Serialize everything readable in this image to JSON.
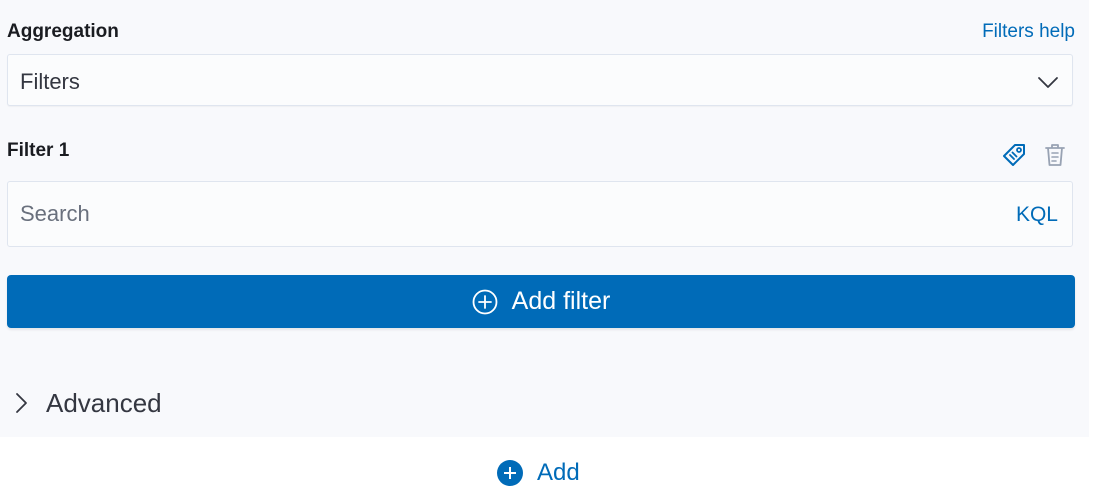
{
  "aggregation": {
    "label": "Aggregation",
    "help_link": "Filters help",
    "selected": "Filters"
  },
  "filter1": {
    "label": "Filter 1",
    "search_placeholder": "Search",
    "search_value": "",
    "language": "KQL"
  },
  "buttons": {
    "add_filter": "Add filter",
    "advanced": "Advanced",
    "add": "Add"
  },
  "icons": {
    "select_toggle": "chevron-down-icon",
    "label_filter": "tag-icon",
    "remove_filter": "trash-icon",
    "add_filter": "plus-circle-icon",
    "advanced_toggle": "chevron-right-icon",
    "add": "plus-circle-filled-icon"
  },
  "colors": {
    "accent": "#006bb8",
    "panel_bg": "#f8f9fc",
    "text": "#343741"
  }
}
